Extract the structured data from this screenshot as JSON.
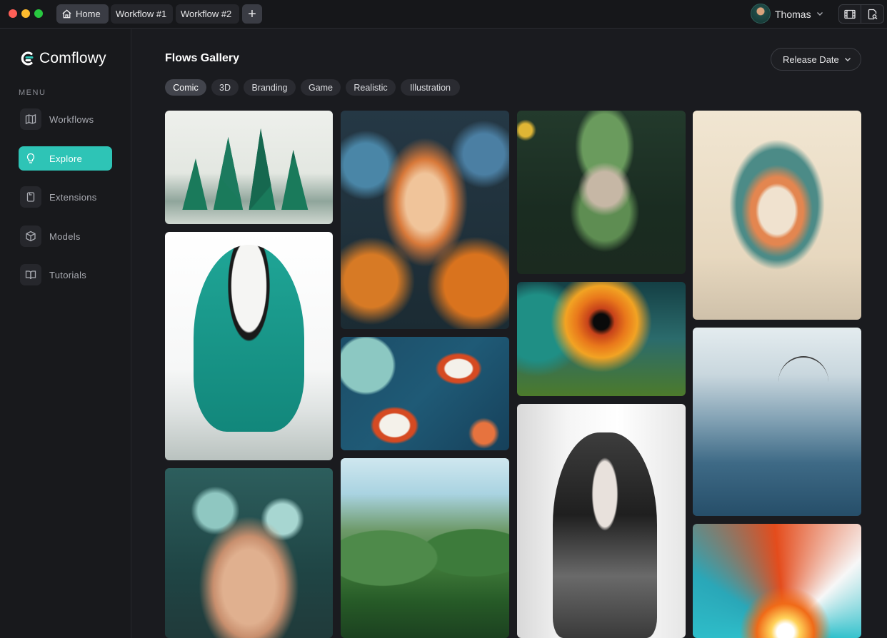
{
  "titlebar": {
    "tabs": [
      {
        "label": "Home",
        "icon": "home-icon",
        "active": true
      },
      {
        "label": "Workflow #1",
        "active": false
      },
      {
        "label": "Workflow #2",
        "active": false
      }
    ],
    "add_tab_label": "+",
    "user": {
      "name": "Thomas",
      "avatar": "avatar"
    },
    "actions": [
      {
        "icon": "film-icon"
      },
      {
        "icon": "document-search-icon"
      }
    ]
  },
  "sidebar": {
    "brand": "Comflowy",
    "menu_label": "MENU",
    "items": [
      {
        "label": "Workflows",
        "icon": "map-icon",
        "active": false
      },
      {
        "label": "Explore",
        "icon": "lightbulb-icon",
        "active": true
      },
      {
        "label": "Extensions",
        "icon": "puzzle-icon",
        "active": false
      },
      {
        "label": "Models",
        "icon": "cube-icon",
        "active": false
      },
      {
        "label": "Tutorials",
        "icon": "book-icon",
        "active": false
      }
    ]
  },
  "main": {
    "title": "Flows Gallery",
    "sort": {
      "label": "Release Date"
    },
    "filters": [
      {
        "label": "Comic",
        "active": true
      },
      {
        "label": "3D",
        "active": false
      },
      {
        "label": "Branding",
        "active": false
      },
      {
        "label": "Game",
        "active": false
      },
      {
        "label": "Realistic",
        "active": false
      },
      {
        "label": "Illustration",
        "active": false
      }
    ],
    "gallery": [
      {
        "subject": "low-poly pine trees"
      },
      {
        "subject": "panda in teal hoodie"
      },
      {
        "subject": "woman with floral hair"
      },
      {
        "subject": "fox among flowers"
      },
      {
        "subject": "koi fish pond"
      },
      {
        "subject": "jungle cliffs"
      },
      {
        "subject": "hamster in green knit hat"
      },
      {
        "subject": "orange paper flower"
      },
      {
        "subject": "anime girl with headphones"
      },
      {
        "subject": "ornate mask face"
      },
      {
        "subject": "lone tree in misty dunes"
      },
      {
        "subject": "colorful sunburst"
      }
    ]
  },
  "colors": {
    "accent": "#2ec4b6",
    "background": "#1a1b1f",
    "sidebar": "#18191c",
    "chip": "#2a2b31",
    "chip_active": "#42444c"
  }
}
